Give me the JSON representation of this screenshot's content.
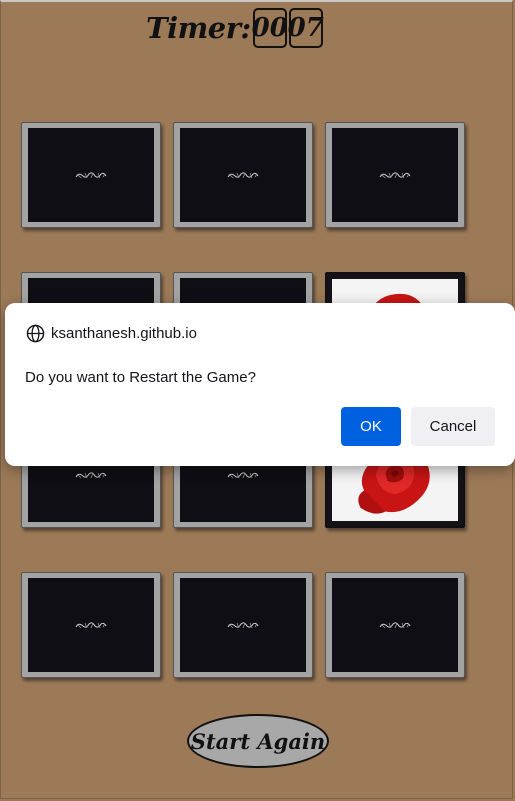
{
  "timer": {
    "label": "Timer:",
    "minutes": "00",
    "seconds": "07"
  },
  "board": {
    "cards": [
      {
        "state": "face-down",
        "icon": "pattern-icon"
      },
      {
        "state": "face-down",
        "icon": "pattern-icon"
      },
      {
        "state": "face-down",
        "icon": "pattern-icon"
      },
      {
        "state": "face-down",
        "icon": "pattern-icon"
      },
      {
        "state": "face-down",
        "icon": "pattern-icon"
      },
      {
        "state": "face-up",
        "icon": "rose-icon"
      },
      {
        "state": "face-down",
        "icon": "pattern-icon"
      },
      {
        "state": "face-down",
        "icon": "pattern-icon"
      },
      {
        "state": "face-up",
        "icon": "rose-icon"
      },
      {
        "state": "face-down",
        "icon": "pattern-icon"
      },
      {
        "state": "face-down",
        "icon": "pattern-icon"
      },
      {
        "state": "face-down",
        "icon": "pattern-icon"
      }
    ]
  },
  "start_again": {
    "label": "Start Again"
  },
  "dialog": {
    "origin": "ksanthanesh.github.io",
    "message": "Do you want to Restart the Game?",
    "ok_label": "OK",
    "cancel_label": "Cancel",
    "ok_color": "#0061e0"
  },
  "colors": {
    "background": "#9c7a58",
    "card_back": "#0f0e14",
    "card_frame": "#a3a3a3"
  }
}
